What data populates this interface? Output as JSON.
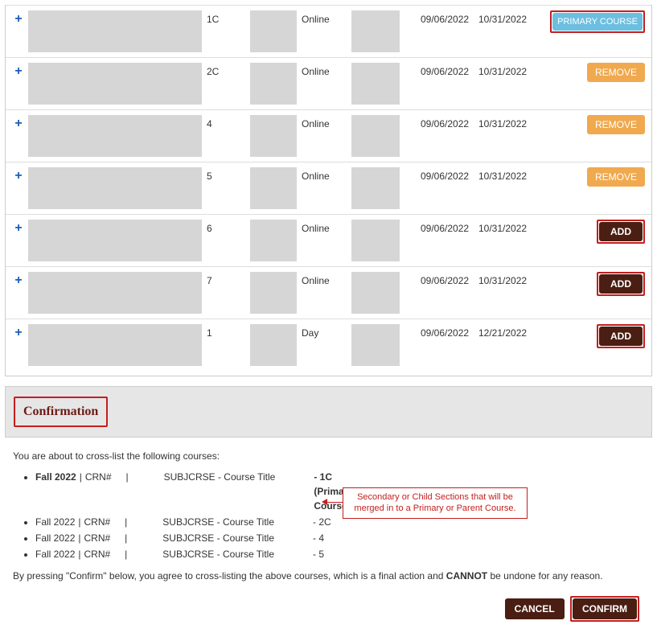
{
  "table": {
    "rows": [
      {
        "section": "1C",
        "mode": "Online",
        "start": "09/06/2022",
        "end": "10/31/2022",
        "action": "primary",
        "action_label": "PRIMARY COURSE",
        "red_box": true
      },
      {
        "section": "2C",
        "mode": "Online",
        "start": "09/06/2022",
        "end": "10/31/2022",
        "action": "remove",
        "action_label": "REMOVE",
        "red_box": false
      },
      {
        "section": "4",
        "mode": "Online",
        "start": "09/06/2022",
        "end": "10/31/2022",
        "action": "remove",
        "action_label": "REMOVE",
        "red_box": false
      },
      {
        "section": "5",
        "mode": "Online",
        "start": "09/06/2022",
        "end": "10/31/2022",
        "action": "remove",
        "action_label": "REMOVE",
        "red_box": false
      },
      {
        "section": "6",
        "mode": "Online",
        "start": "09/06/2022",
        "end": "10/31/2022",
        "action": "add",
        "action_label": "ADD",
        "red_box": true
      },
      {
        "section": "7",
        "mode": "Online",
        "start": "09/06/2022",
        "end": "10/31/2022",
        "action": "add",
        "action_label": "ADD",
        "red_box": true
      },
      {
        "section": "1",
        "mode": "Day",
        "start": "09/06/2022",
        "end": "12/21/2022",
        "action": "add",
        "action_label": "ADD",
        "red_box": true
      }
    ]
  },
  "confirmation": {
    "title": "Confirmation",
    "intro": "You are about to cross-list the following courses:",
    "items": [
      {
        "term_bold": true,
        "term": "Fall 2022",
        "crn_label": "CRN#",
        "subjcrse": "SUBJCRSE - Course Title",
        "sec": "- 1C (Primary Course)"
      },
      {
        "term_bold": false,
        "term": "Fall 2022",
        "crn_label": "CRN#",
        "subjcrse": "SUBJCRSE - Course Title",
        "sec": "- 2C"
      },
      {
        "term_bold": false,
        "term": "Fall 2022",
        "crn_label": "CRN#",
        "subjcrse": "SUBJCRSE - Course Title",
        "sec": "- 4"
      },
      {
        "term_bold": false,
        "term": "Fall 2022",
        "crn_label": "CRN#",
        "subjcrse": "SUBJCRSE - Course Title",
        "sec": "- 5"
      }
    ],
    "legis_pre": "By pressing \"Confirm\" below, you agree to cross-listing the above courses, which is a final action and ",
    "legis_bold": "CANNOT",
    "legis_post": " be undone for any reason.",
    "cancel_label": "CANCEL",
    "confirm_label": "CONFIRM",
    "callout": "Secondary or Child Sections that will be merged in to a Primary or Parent Course."
  }
}
